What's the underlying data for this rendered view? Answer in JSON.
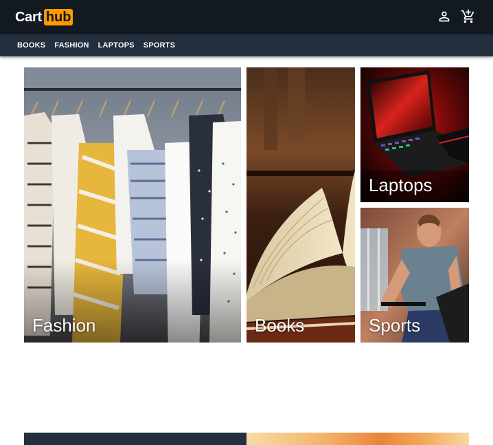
{
  "header": {
    "logo_part1": "Cart",
    "logo_part2": "hub",
    "icons": [
      "account-icon",
      "cart-icon"
    ]
  },
  "nav": {
    "items": [
      "BOOKS",
      "FASHION",
      "LAPTOPS",
      "SPORTS"
    ]
  },
  "categories": {
    "fashion": "Fashion",
    "books": "Books",
    "laptops": "Laptops",
    "sports": "Sports"
  },
  "colors": {
    "header_bg": "#131921",
    "nav_bg": "#232f3e",
    "accent": "#ff9900"
  }
}
